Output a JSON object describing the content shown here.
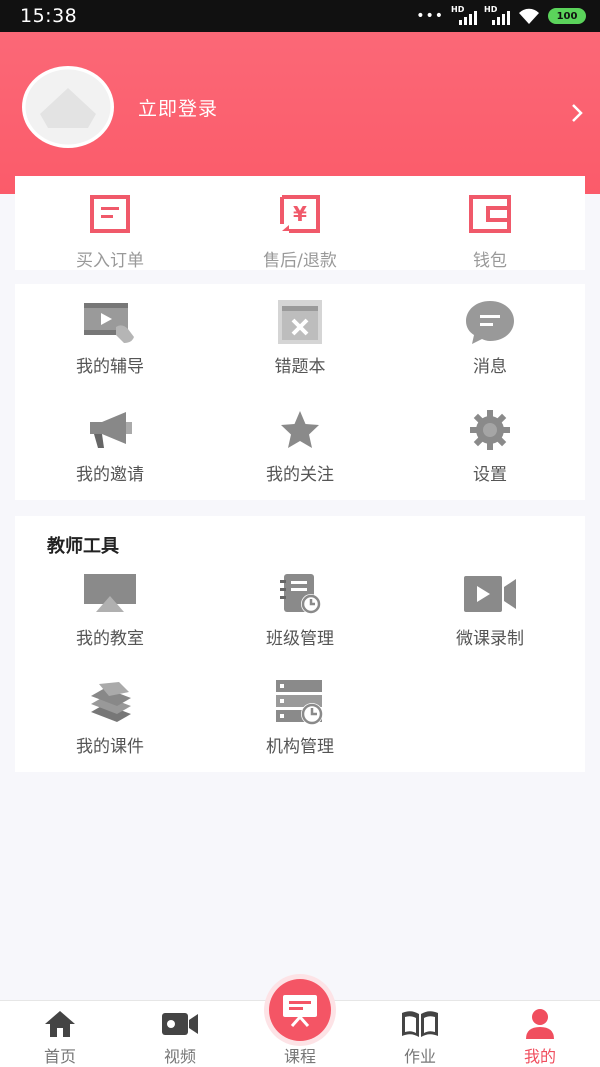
{
  "status_bar": {
    "time": "15:38",
    "battery": "100"
  },
  "header": {
    "login_label": "立即登录"
  },
  "orders": [
    {
      "label": "买入订单",
      "icon": "order-icon"
    },
    {
      "label": "售后/退款",
      "icon": "refund-icon"
    },
    {
      "label": "钱包",
      "icon": "wallet-icon"
    }
  ],
  "tools": [
    {
      "label": "我的辅导",
      "icon": "tutoring-icon"
    },
    {
      "label": "错题本",
      "icon": "mistake-book-icon"
    },
    {
      "label": "消息",
      "icon": "message-icon"
    },
    {
      "label": "我的邀请",
      "icon": "megaphone-icon"
    },
    {
      "label": "我的关注",
      "icon": "star-icon"
    },
    {
      "label": "设置",
      "icon": "gear-icon"
    }
  ],
  "teacher": {
    "title": "教师工具",
    "items": [
      {
        "label": "我的教室",
        "icon": "classroom-icon"
      },
      {
        "label": "班级管理",
        "icon": "class-manage-icon"
      },
      {
        "label": "微课录制",
        "icon": "video-record-icon"
      },
      {
        "label": "我的课件",
        "icon": "books-icon"
      },
      {
        "label": "机构管理",
        "icon": "server-clock-icon"
      }
    ]
  },
  "tabbar": {
    "tabs": [
      {
        "label": "首页",
        "icon": "home-icon"
      },
      {
        "label": "视频",
        "icon": "camera-icon"
      },
      {
        "label": "课程",
        "icon": "board-icon"
      },
      {
        "label": "作业",
        "icon": "book-open-icon"
      },
      {
        "label": "我的",
        "icon": "user-icon"
      }
    ],
    "active_index": 4
  },
  "colors": {
    "accent": "#fb5b6a",
    "active_tab": "#f04e5e",
    "icon_gray": "#8a8a8a"
  }
}
